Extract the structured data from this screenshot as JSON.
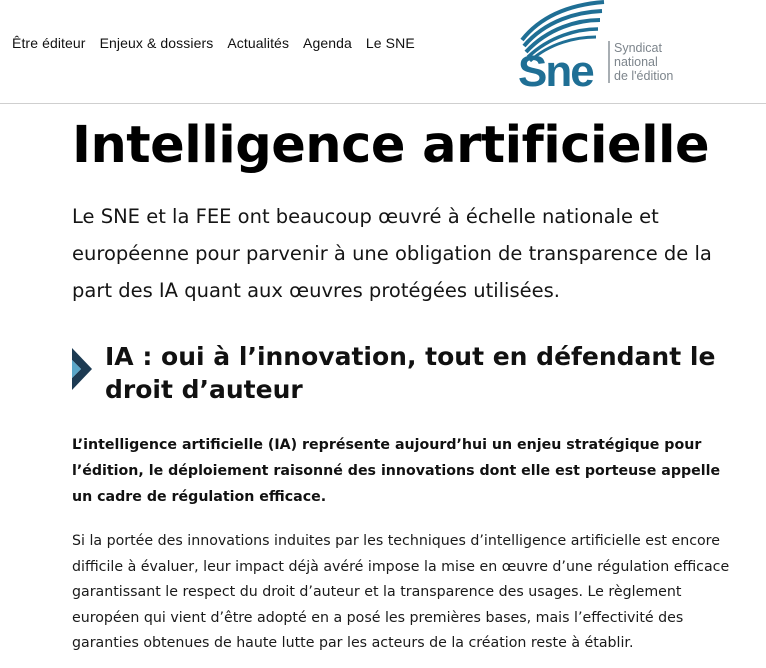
{
  "nav": {
    "items": [
      {
        "label": "Être éditeur"
      },
      {
        "label": "Enjeux & dossiers"
      },
      {
        "label": "Actualités"
      },
      {
        "label": "Agenda"
      },
      {
        "label": "Le SNE"
      }
    ]
  },
  "logo": {
    "mark": "Sne",
    "tag_lines": [
      "Syndicat",
      "national",
      "de l'édition"
    ]
  },
  "page": {
    "title": "Intelligence artificielle",
    "lead": "Le SNE et la FEE ont beaucoup œuvré à échelle nationale et européenne pour parvenir à une obligation de transparence de la part des IA quant aux œuvres protégées utilisées.",
    "section_heading": "IA : oui à l’innovation, tout en défendant le droit d’auteur",
    "intro": "L’intelligence artificielle (IA) représente aujourd’hui un enjeu stratégique pour l’édition, le déploiement raisonné des innovations dont elle est porteuse appelle un cadre de régulation efficace.",
    "body": "Si la portée des innovations induites par les techniques d’intelligence artificielle est encore difficile à évaluer, leur impact déjà avéré impose la mise en œuvre d’une régulation efficace garantissant le respect du droit d’auteur et la transparence des usages. Le règlement européen qui vient d’être adopté en a posé les premières bases, mais l’effectivité des garanties obtenues de haute lutte par les acteurs de la création reste à établir."
  },
  "colors": {
    "brand_blue": "#1f6f95",
    "chevron_dark": "#1d3b53",
    "chevron_light": "#5aa6c8",
    "logo_gray": "#7d858c"
  }
}
